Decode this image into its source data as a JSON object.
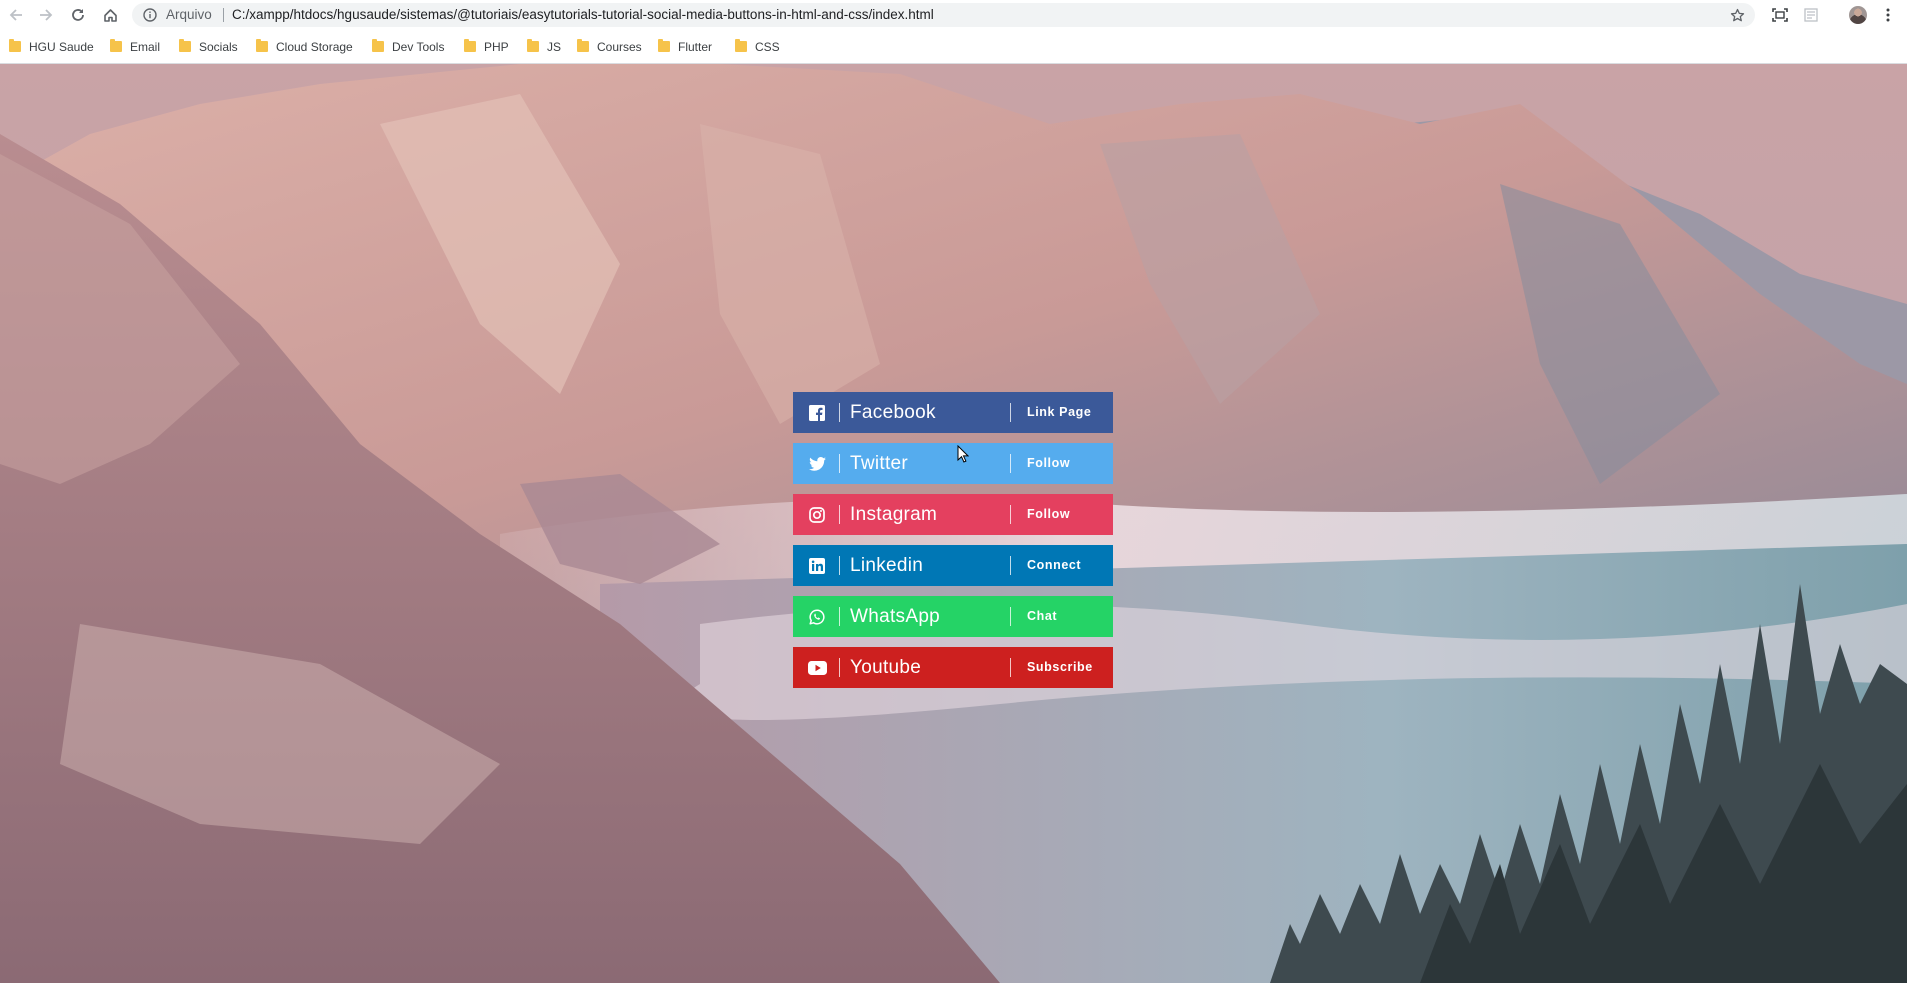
{
  "browser": {
    "address_label": "Arquivo",
    "url": "C:/xampp/htdocs/hgusaude/sistemas/@tutoriais/easytutorials-tutorial-social-media-buttons-in-html-and-css/index.html",
    "bookmarks": [
      {
        "label": "HGU Saude"
      },
      {
        "label": "Email"
      },
      {
        "label": "Socials"
      },
      {
        "label": "Cloud Storage"
      },
      {
        "label": "Dev Tools"
      },
      {
        "label": "PHP"
      },
      {
        "label": "JS"
      },
      {
        "label": "Courses"
      },
      {
        "label": "Flutter"
      },
      {
        "label": "CSS"
      }
    ]
  },
  "social_buttons": [
    {
      "name": "Facebook",
      "action": "Link Page",
      "color": "#3b5999",
      "icon": "facebook-icon"
    },
    {
      "name": "Twitter",
      "action": "Follow",
      "color": "#55acee",
      "icon": "twitter-icon"
    },
    {
      "name": "Instagram",
      "action": "Follow",
      "color": "#e4405f",
      "icon": "instagram-icon"
    },
    {
      "name": "Linkedin",
      "action": "Connect",
      "color": "#0077b5",
      "icon": "linkedin-icon"
    },
    {
      "name": "WhatsApp",
      "action": "Chat",
      "color": "#25d366",
      "icon": "whatsapp-icon"
    },
    {
      "name": "Youtube",
      "action": "Subscribe",
      "color": "#cd201f",
      "icon": "youtube-icon"
    }
  ]
}
